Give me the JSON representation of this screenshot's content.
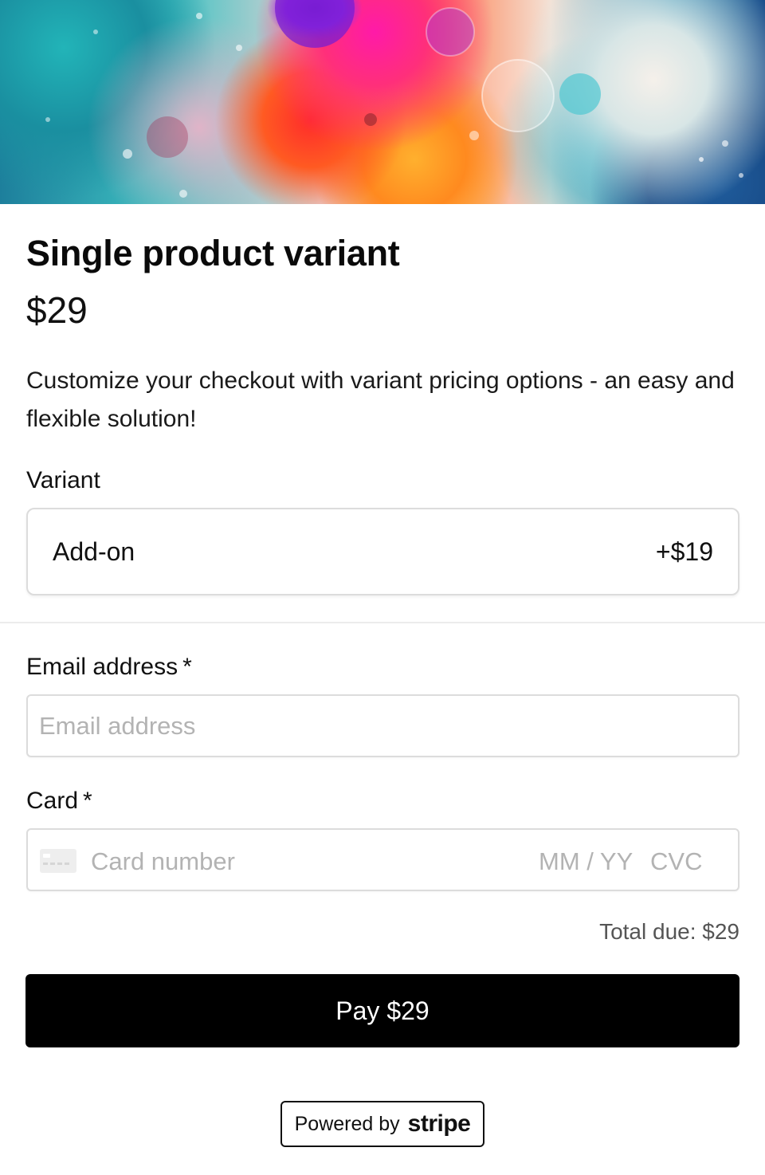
{
  "hero": {
    "image": "abstract-colorful-oil-bubbles-image"
  },
  "product": {
    "title": "Single product variant",
    "price": "$29",
    "description": "Customize your checkout with variant pricing options - an easy and flexible solution!"
  },
  "variant": {
    "label": "Variant",
    "selected_name": "Add-on",
    "selected_price": "+$19"
  },
  "email": {
    "label": "Email address",
    "required_mark": "*",
    "placeholder": "Email address",
    "value": ""
  },
  "card": {
    "label": "Card",
    "required_mark": "*",
    "icon": "credit-card-icon",
    "number_placeholder": "Card number",
    "expiry_placeholder": "MM / YY",
    "cvc_placeholder": "CVC"
  },
  "summary": {
    "total_due": "Total due: $29"
  },
  "actions": {
    "pay_label": "Pay $29"
  },
  "footer": {
    "powered_by": "Powered by",
    "brand": "stripe"
  },
  "colors": {
    "button": "#000000",
    "border": "#dcdcdc",
    "placeholder": "#b3b3b3"
  }
}
